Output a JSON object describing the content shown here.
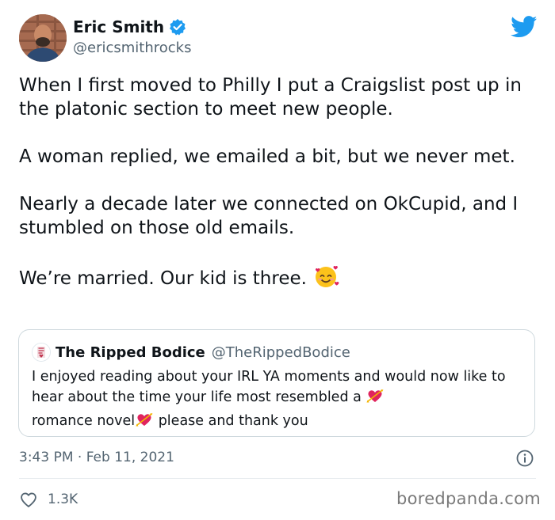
{
  "author": {
    "name": "Eric Smith",
    "handle": "@ericsmithrocks",
    "verified": true
  },
  "tweet": {
    "paragraphs": [
      "When I first moved to Philly I put a Craigslist post up in the platonic section to meet new people.",
      "A woman replied, we emailed a bit, but we never met.",
      "Nearly a decade later we connected on OkCupid, and I stumbled on those old emails.",
      "We’re married. Our kid is three."
    ],
    "final_emoji": "smiling-face-with-hearts"
  },
  "quote": {
    "name": "The Ripped Bodice",
    "handle": "@TheRippedBodice",
    "text_part1": "I enjoyed reading about your IRL YA  moments and would now like to hear about the time your life most resembled a",
    "text_part2": "romance novel",
    "text_part3": "please and thank you",
    "emoji": "heart-with-arrow"
  },
  "meta": {
    "timestamp": "3:43 PM · Feb 11, 2021"
  },
  "engagement": {
    "likes": "1.3K"
  },
  "watermark": "boredpanda.com",
  "colors": {
    "twitter_blue": "#1d9bf0",
    "text_primary": "#0f1419",
    "text_secondary": "#536471",
    "border": "#cfd9de"
  }
}
